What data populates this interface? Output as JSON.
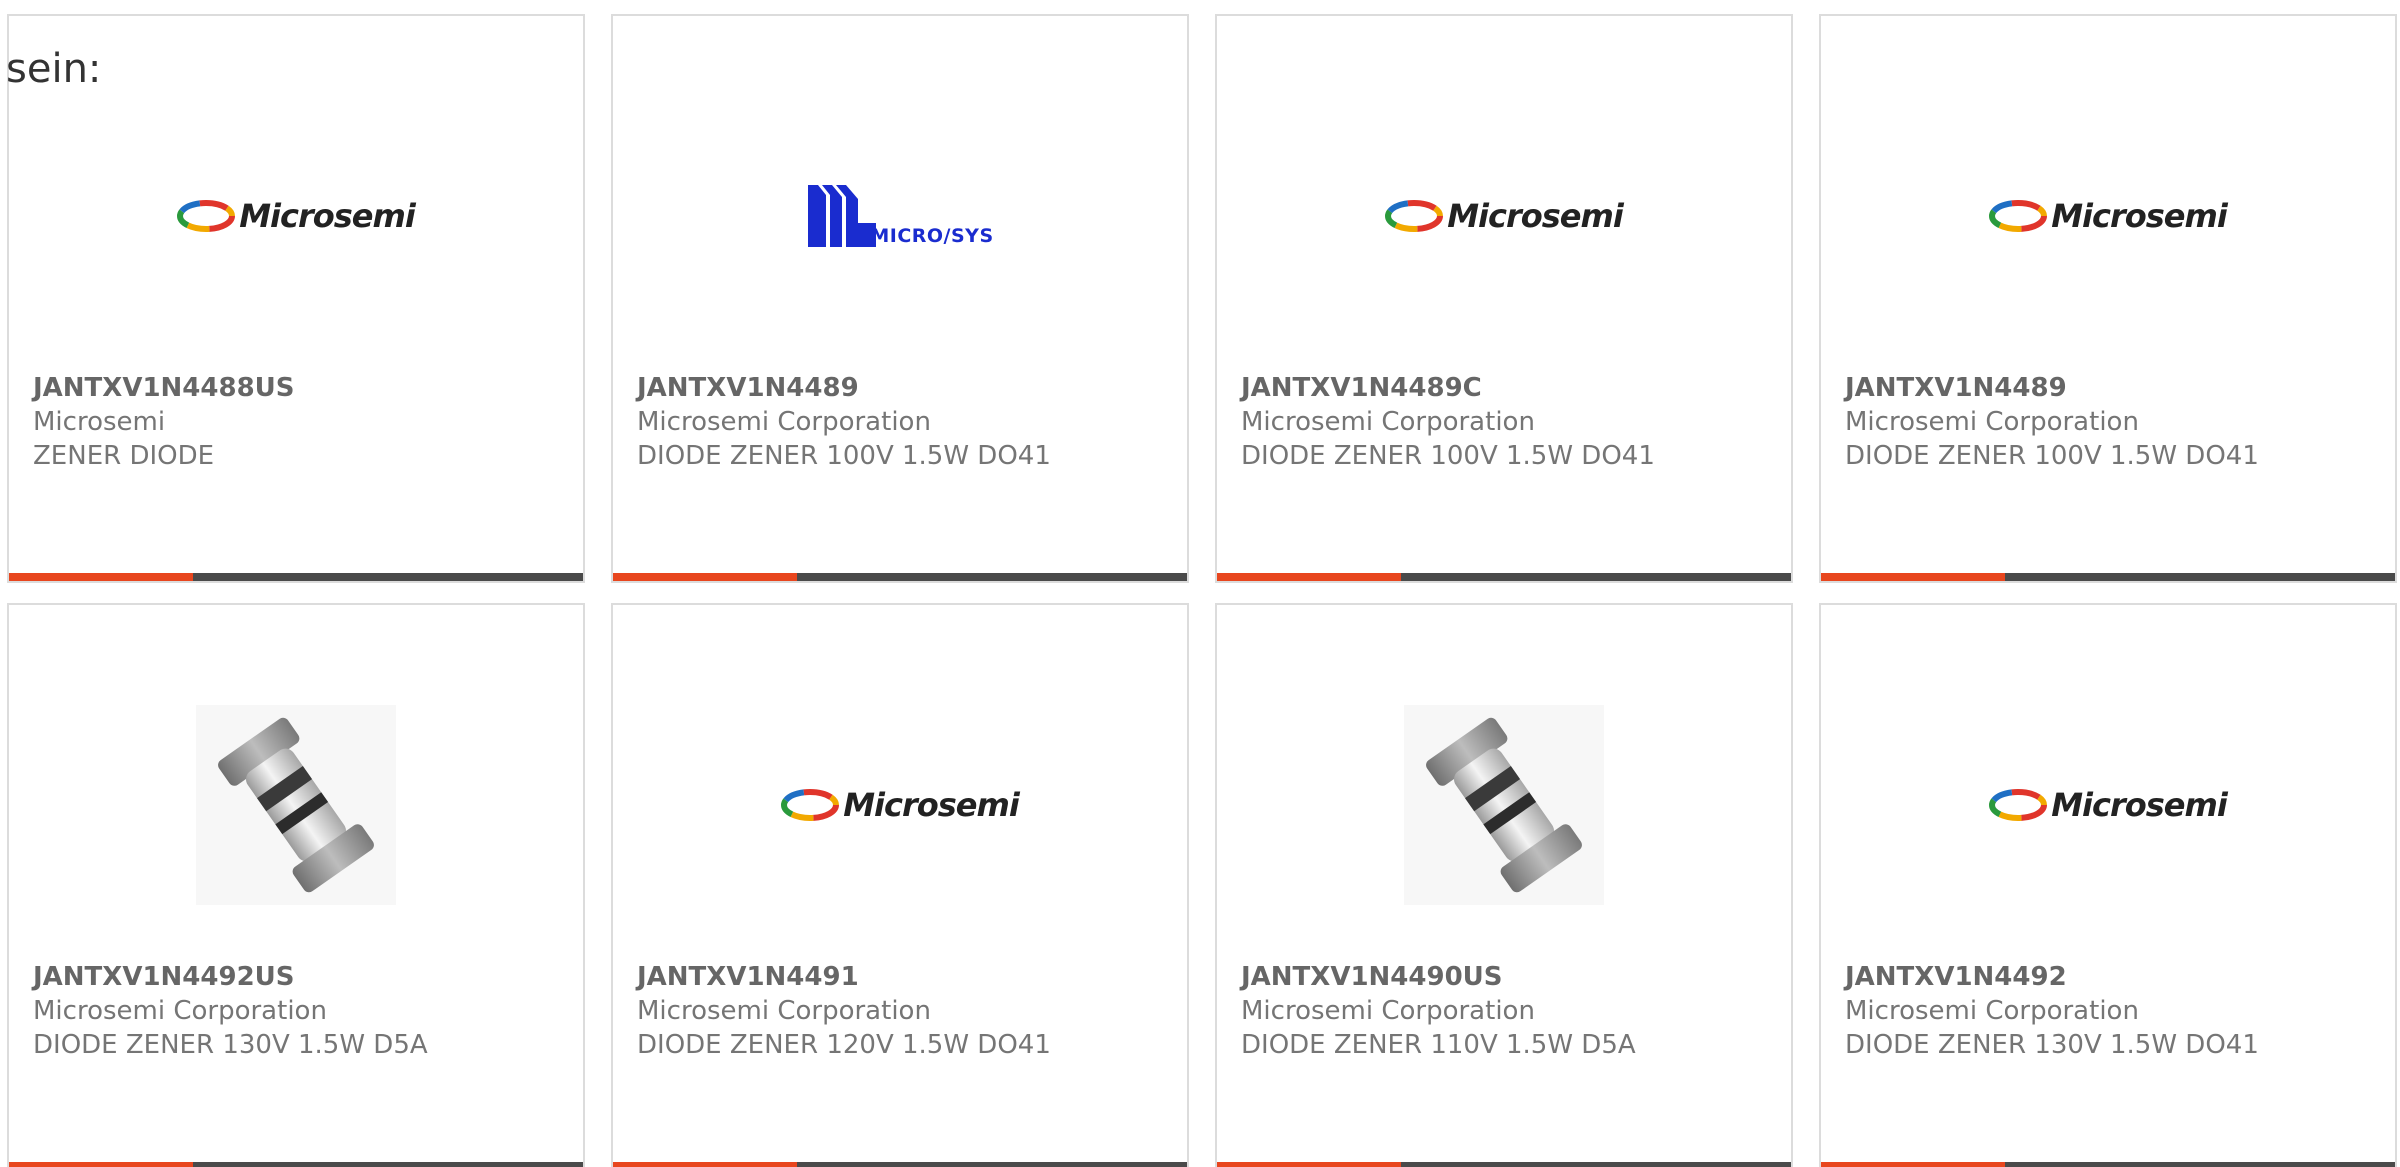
{
  "intro_text": "sein:",
  "colors": {
    "accent": "#e8461e",
    "bar": "#4a4a4a",
    "border": "#dcdcdc"
  },
  "cards": [
    {
      "part": "JANTXV1N4488US",
      "manufacturer": "Microsemi",
      "description": "ZENER DIODE",
      "image": "microsemi-logo",
      "logo_text": "Microsemi"
    },
    {
      "part": "JANTXV1N4489",
      "manufacturer": "Microsemi Corporation",
      "description": "DIODE ZENER 100V 1.5W DO41",
      "image": "microsys-logo",
      "logo_text": "MICRO/SYS"
    },
    {
      "part": "JANTXV1N4489C",
      "manufacturer": "Microsemi Corporation",
      "description": "DIODE ZENER 100V 1.5W DO41",
      "image": "microsemi-logo",
      "logo_text": "Microsemi"
    },
    {
      "part": "JANTXV1N4489",
      "manufacturer": "Microsemi Corporation",
      "description": "DIODE ZENER 100V 1.5W DO41",
      "image": "microsemi-logo",
      "logo_text": "Microsemi"
    },
    {
      "part": "JANTXV1N4492US",
      "manufacturer": "Microsemi Corporation",
      "description": "DIODE ZENER 130V 1.5W D5A",
      "image": "diode-photo"
    },
    {
      "part": "JANTXV1N4491",
      "manufacturer": "Microsemi Corporation",
      "description": "DIODE ZENER 120V 1.5W DO41",
      "image": "microsemi-logo",
      "logo_text": "Microsemi"
    },
    {
      "part": "JANTXV1N4490US",
      "manufacturer": "Microsemi Corporation",
      "description": "DIODE ZENER 110V 1.5W D5A",
      "image": "diode-photo"
    },
    {
      "part": "JANTXV1N4492",
      "manufacturer": "Microsemi Corporation",
      "description": "DIODE ZENER 130V 1.5W DO41",
      "image": "microsemi-logo",
      "logo_text": "Microsemi"
    }
  ]
}
